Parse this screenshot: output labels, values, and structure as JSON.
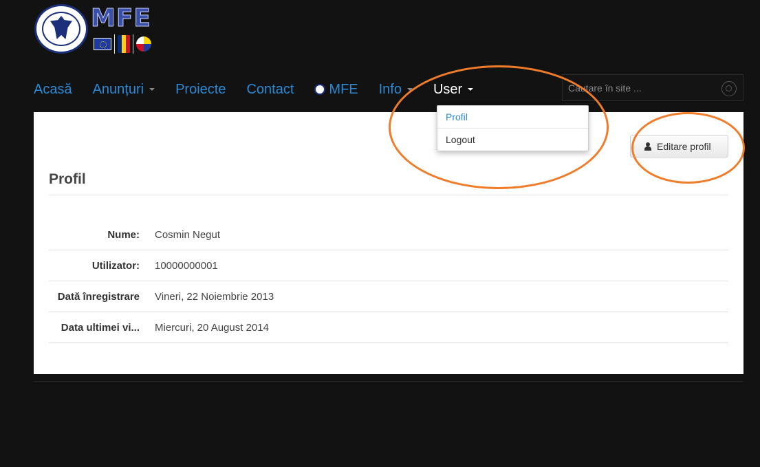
{
  "header": {
    "logo_text": "MFE",
    "logo_alt": "Ministerul Fondurilor Europene"
  },
  "nav": {
    "items": [
      {
        "label": "Acasă"
      },
      {
        "label": "Anunțuri"
      },
      {
        "label": "Proiecte"
      },
      {
        "label": "Contact"
      },
      {
        "label": "MFE"
      },
      {
        "label": "Info"
      },
      {
        "label": "User"
      }
    ]
  },
  "search": {
    "placeholder": "Căutare în site ..."
  },
  "user_menu": {
    "items": [
      {
        "label": "Profil"
      },
      {
        "label": "Logout"
      }
    ]
  },
  "profile": {
    "title": "Profil",
    "edit_label": "Editare profil",
    "fields": [
      {
        "label": "Nume:",
        "value": "Cosmin Negut"
      },
      {
        "label": "Utilizator:",
        "value": "10000000001"
      },
      {
        "label": "Dată înregistrare",
        "value": "Vineri, 22 Noiembrie 2013"
      },
      {
        "label": "Data ultimei vi...",
        "value": "Miercuri, 20 August 2014"
      }
    ]
  },
  "colors": {
    "nav_link": "#2b8ad6",
    "nav_active": "#ffffff",
    "annotation": "#f07c2a",
    "background": "#121212"
  }
}
